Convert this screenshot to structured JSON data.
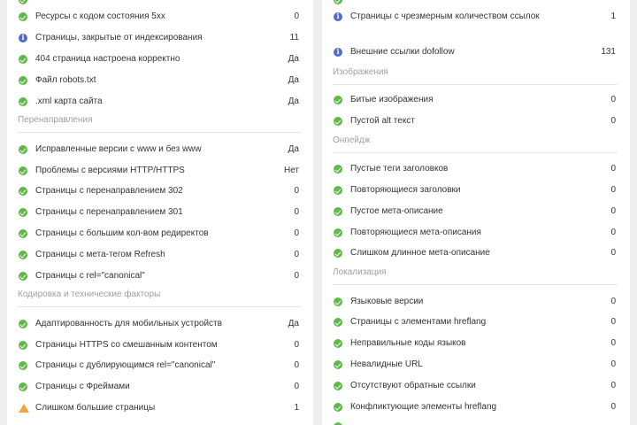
{
  "left": {
    "rows": [
      {
        "label": "Ресурсы с кодом состояния 5xx",
        "value": "0",
        "icon": "check-icon"
      },
      {
        "label": "Страницы, закрытые от индексирования",
        "value": "11",
        "icon": "info-icon"
      },
      {
        "label": "404 страница настроена корректно",
        "value": "Да",
        "icon": "check-icon"
      },
      {
        "label": "Файл robots.txt",
        "value": "Да",
        "icon": "check-icon"
      },
      {
        "label": ".xml карта сайта",
        "value": "Да",
        "icon": "check-icon"
      },
      {
        "label": "Исправленные версии с www и без www",
        "value": "Да",
        "icon": "check-icon"
      },
      {
        "label": "Проблемы с версиями HTTP/HTTPS",
        "value": "Нет",
        "icon": "check-icon"
      },
      {
        "label": "Страницы с перенаправлением 302",
        "value": "0",
        "icon": "check-icon"
      },
      {
        "label": "Страницы с перенаправлением 301",
        "value": "0",
        "icon": "check-icon"
      },
      {
        "label": "Страницы с большим кол-вом редиректов",
        "value": "0",
        "icon": "check-icon"
      },
      {
        "label": "Страницы с мета-тегом Refresh",
        "value": "0",
        "icon": "check-icon"
      },
      {
        "label": "Страницы с rel=\"canonical\"",
        "value": "0",
        "icon": "check-icon"
      },
      {
        "label": "Адаптированность для мобильных устройств",
        "value": "Да",
        "icon": "check-icon"
      },
      {
        "label": "Страницы HTTPS со смешанным контентом",
        "value": "0",
        "icon": "check-icon"
      },
      {
        "label": "Страницы с дублирующимся rel=\"canonical\"",
        "value": "0",
        "icon": "check-icon"
      },
      {
        "label": "Страницы с Фреймами",
        "value": "0",
        "icon": "check-icon"
      },
      {
        "label": "Слишком большие страницы",
        "value": "1",
        "icon": "warning-icon"
      }
    ],
    "sections": {
      "redirects": "Перенаправления",
      "encoding": "Кодировка и технические факторы"
    }
  },
  "right": {
    "rows": [
      {
        "label": "Страницы с чрезмерным количеством ссылок",
        "value": "1",
        "icon": "info-icon"
      },
      {
        "label": "Внешние ссылки dofollow",
        "value": "131",
        "icon": "info-icon"
      },
      {
        "label": "Битые изображения",
        "value": "0",
        "icon": "check-icon"
      },
      {
        "label": "Пустой alt текст",
        "value": "0",
        "icon": "check-icon"
      },
      {
        "label": "Пустые теги заголовков",
        "value": "0",
        "icon": "check-icon"
      },
      {
        "label": "Повторяющиеся заголовки",
        "value": "0",
        "icon": "check-icon"
      },
      {
        "label": "Пустое мета-описание",
        "value": "0",
        "icon": "check-icon"
      },
      {
        "label": "Повторяющиеся мета-описания",
        "value": "0",
        "icon": "check-icon"
      },
      {
        "label": "Слишком длинное мета-описание",
        "value": "0",
        "icon": "check-icon"
      },
      {
        "label": "Языковые версии",
        "value": "0",
        "icon": "check-icon"
      },
      {
        "label": "Страницы с элементами hreflang",
        "value": "0",
        "icon": "check-icon"
      },
      {
        "label": "Неправильные коды языков",
        "value": "0",
        "icon": "check-icon"
      },
      {
        "label": "Невалидные URL",
        "value": "0",
        "icon": "check-icon"
      },
      {
        "label": "Отсутствуют обратные ссылки",
        "value": "0",
        "icon": "check-icon"
      },
      {
        "label": "Конфликтующие элементы hreflang",
        "value": "0",
        "icon": "check-icon"
      }
    ],
    "sections": {
      "images": "Изображения",
      "onpage": "Онпейдж",
      "localization": "Локализация"
    }
  },
  "colors": {
    "ok": "#5fb946",
    "info": "#4f6bc7",
    "warning": "#f3a73b",
    "section_label": "#9aa0a6"
  }
}
